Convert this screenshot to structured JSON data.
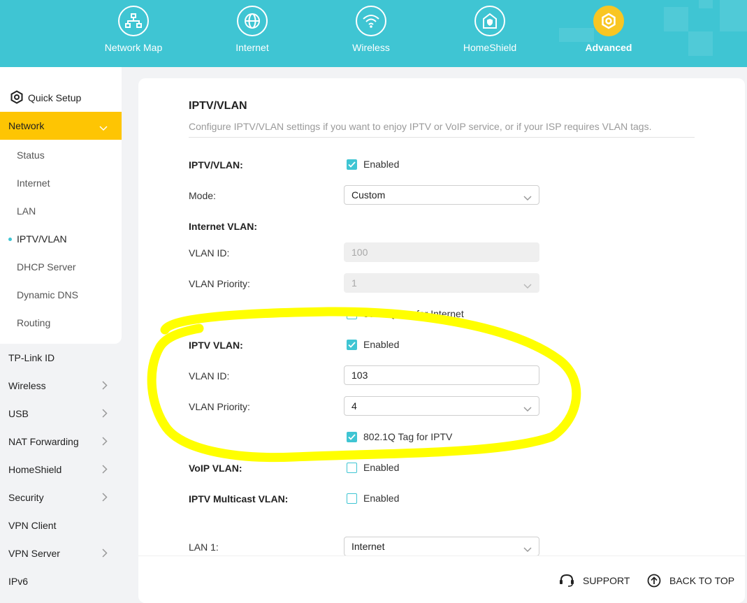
{
  "colors": {
    "accent": "#3fc5d3",
    "active_menu": "#fec503",
    "advanced_icon": "#f9c623",
    "annotation": "#ffff00"
  },
  "topnav": {
    "items": [
      {
        "label": "Network Map",
        "icon": "network-map-icon"
      },
      {
        "label": "Internet",
        "icon": "globe-icon"
      },
      {
        "label": "Wireless",
        "icon": "wifi-icon"
      },
      {
        "label": "HomeShield",
        "icon": "home-shield-icon"
      },
      {
        "label": "Advanced",
        "icon": "gear-icon",
        "active": true
      }
    ]
  },
  "sidebar": {
    "quick_setup": "Quick Setup",
    "network": "Network",
    "network_sub": [
      "Status",
      "Internet",
      "LAN",
      "IPTV/VLAN",
      "DHCP Server",
      "Dynamic DNS",
      "Routing"
    ],
    "active_sub": "IPTV/VLAN",
    "items": [
      "TP-Link ID",
      "Wireless",
      "USB",
      "NAT Forwarding",
      "HomeShield",
      "Security",
      "VPN Client",
      "VPN Server",
      "IPv6"
    ]
  },
  "main": {
    "title": "IPTV/VLAN",
    "description": "Configure IPTV/VLAN settings if you want to enjoy IPTV or VoIP service, or if your ISP requires VLAN tags.",
    "iptv_vlan": {
      "label": "IPTV/VLAN:",
      "checkbox": "Enabled",
      "checked": true
    },
    "mode": {
      "label": "Mode:",
      "value": "Custom"
    },
    "internet_vlan": {
      "heading": "Internet VLAN:",
      "vlan_id_label": "VLAN ID:",
      "vlan_id_value": "100",
      "priority_label": "VLAN Priority:",
      "priority_value": "1",
      "tag_label": "802.1Q Tag for Internet",
      "tag_checked": false
    },
    "iptv_vlan_section": {
      "heading": "IPTV VLAN:",
      "checkbox": "Enabled",
      "checked": true,
      "vlan_id_label": "VLAN ID:",
      "vlan_id_value": "103",
      "priority_label": "VLAN Priority:",
      "priority_value": "4",
      "tag_label": "802.1Q Tag for IPTV",
      "tag_checked": true
    },
    "voip_vlan": {
      "label": "VoIP VLAN:",
      "checkbox": "Enabled",
      "checked": false
    },
    "iptv_multicast": {
      "label": "IPTV Multicast VLAN:",
      "checkbox": "Enabled",
      "checked": false
    },
    "lan1": {
      "label": "LAN 1:",
      "value": "Internet"
    }
  },
  "footer": {
    "support": "SUPPORT",
    "back_to_top": "BACK TO TOP"
  }
}
